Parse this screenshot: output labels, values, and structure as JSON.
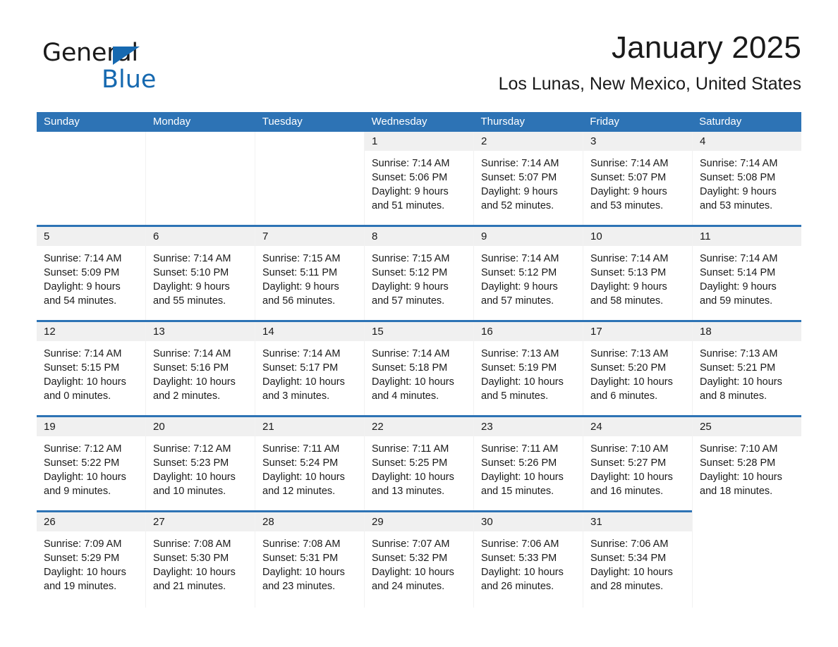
{
  "brand": {
    "name_part1": "General",
    "name_part2": "Blue",
    "accent_color": "#1669b0"
  },
  "header": {
    "month_title": "January 2025",
    "location": "Los Lunas, New Mexico, United States"
  },
  "theme": {
    "header_blue": "#2d73b5",
    "datenum_gray": "#f0f0f0",
    "cell_white": "#ffffff"
  },
  "weekdays": [
    "Sunday",
    "Monday",
    "Tuesday",
    "Wednesday",
    "Thursday",
    "Friday",
    "Saturday"
  ],
  "weeks": [
    [
      {
        "day": "",
        "lines": [],
        "blank": true
      },
      {
        "day": "",
        "lines": [],
        "blank": true
      },
      {
        "day": "",
        "lines": [],
        "blank": true
      },
      {
        "day": "1",
        "lines": [
          "Sunrise: 7:14 AM",
          "Sunset: 5:06 PM",
          "Daylight: 9 hours",
          "and 51 minutes."
        ]
      },
      {
        "day": "2",
        "lines": [
          "Sunrise: 7:14 AM",
          "Sunset: 5:07 PM",
          "Daylight: 9 hours",
          "and 52 minutes."
        ]
      },
      {
        "day": "3",
        "lines": [
          "Sunrise: 7:14 AM",
          "Sunset: 5:07 PM",
          "Daylight: 9 hours",
          "and 53 minutes."
        ]
      },
      {
        "day": "4",
        "lines": [
          "Sunrise: 7:14 AM",
          "Sunset: 5:08 PM",
          "Daylight: 9 hours",
          "and 53 minutes."
        ]
      }
    ],
    [
      {
        "day": "5",
        "lines": [
          "Sunrise: 7:14 AM",
          "Sunset: 5:09 PM",
          "Daylight: 9 hours",
          "and 54 minutes."
        ]
      },
      {
        "day": "6",
        "lines": [
          "Sunrise: 7:14 AM",
          "Sunset: 5:10 PM",
          "Daylight: 9 hours",
          "and 55 minutes."
        ]
      },
      {
        "day": "7",
        "lines": [
          "Sunrise: 7:15 AM",
          "Sunset: 5:11 PM",
          "Daylight: 9 hours",
          "and 56 minutes."
        ]
      },
      {
        "day": "8",
        "lines": [
          "Sunrise: 7:15 AM",
          "Sunset: 5:12 PM",
          "Daylight: 9 hours",
          "and 57 minutes."
        ]
      },
      {
        "day": "9",
        "lines": [
          "Sunrise: 7:14 AM",
          "Sunset: 5:12 PM",
          "Daylight: 9 hours",
          "and 57 minutes."
        ]
      },
      {
        "day": "10",
        "lines": [
          "Sunrise: 7:14 AM",
          "Sunset: 5:13 PM",
          "Daylight: 9 hours",
          "and 58 minutes."
        ]
      },
      {
        "day": "11",
        "lines": [
          "Sunrise: 7:14 AM",
          "Sunset: 5:14 PM",
          "Daylight: 9 hours",
          "and 59 minutes."
        ]
      }
    ],
    [
      {
        "day": "12",
        "lines": [
          "Sunrise: 7:14 AM",
          "Sunset: 5:15 PM",
          "Daylight: 10 hours",
          "and 0 minutes."
        ]
      },
      {
        "day": "13",
        "lines": [
          "Sunrise: 7:14 AM",
          "Sunset: 5:16 PM",
          "Daylight: 10 hours",
          "and 2 minutes."
        ]
      },
      {
        "day": "14",
        "lines": [
          "Sunrise: 7:14 AM",
          "Sunset: 5:17 PM",
          "Daylight: 10 hours",
          "and 3 minutes."
        ]
      },
      {
        "day": "15",
        "lines": [
          "Sunrise: 7:14 AM",
          "Sunset: 5:18 PM",
          "Daylight: 10 hours",
          "and 4 minutes."
        ]
      },
      {
        "day": "16",
        "lines": [
          "Sunrise: 7:13 AM",
          "Sunset: 5:19 PM",
          "Daylight: 10 hours",
          "and 5 minutes."
        ]
      },
      {
        "day": "17",
        "lines": [
          "Sunrise: 7:13 AM",
          "Sunset: 5:20 PM",
          "Daylight: 10 hours",
          "and 6 minutes."
        ]
      },
      {
        "day": "18",
        "lines": [
          "Sunrise: 7:13 AM",
          "Sunset: 5:21 PM",
          "Daylight: 10 hours",
          "and 8 minutes."
        ]
      }
    ],
    [
      {
        "day": "19",
        "lines": [
          "Sunrise: 7:12 AM",
          "Sunset: 5:22 PM",
          "Daylight: 10 hours",
          "and 9 minutes."
        ]
      },
      {
        "day": "20",
        "lines": [
          "Sunrise: 7:12 AM",
          "Sunset: 5:23 PM",
          "Daylight: 10 hours",
          "and 10 minutes."
        ]
      },
      {
        "day": "21",
        "lines": [
          "Sunrise: 7:11 AM",
          "Sunset: 5:24 PM",
          "Daylight: 10 hours",
          "and 12 minutes."
        ]
      },
      {
        "day": "22",
        "lines": [
          "Sunrise: 7:11 AM",
          "Sunset: 5:25 PM",
          "Daylight: 10 hours",
          "and 13 minutes."
        ]
      },
      {
        "day": "23",
        "lines": [
          "Sunrise: 7:11 AM",
          "Sunset: 5:26 PM",
          "Daylight: 10 hours",
          "and 15 minutes."
        ]
      },
      {
        "day": "24",
        "lines": [
          "Sunrise: 7:10 AM",
          "Sunset: 5:27 PM",
          "Daylight: 10 hours",
          "and 16 minutes."
        ]
      },
      {
        "day": "25",
        "lines": [
          "Sunrise: 7:10 AM",
          "Sunset: 5:28 PM",
          "Daylight: 10 hours",
          "and 18 minutes."
        ]
      }
    ],
    [
      {
        "day": "26",
        "lines": [
          "Sunrise: 7:09 AM",
          "Sunset: 5:29 PM",
          "Daylight: 10 hours",
          "and 19 minutes."
        ]
      },
      {
        "day": "27",
        "lines": [
          "Sunrise: 7:08 AM",
          "Sunset: 5:30 PM",
          "Daylight: 10 hours",
          "and 21 minutes."
        ]
      },
      {
        "day": "28",
        "lines": [
          "Sunrise: 7:08 AM",
          "Sunset: 5:31 PM",
          "Daylight: 10 hours",
          "and 23 minutes."
        ]
      },
      {
        "day": "29",
        "lines": [
          "Sunrise: 7:07 AM",
          "Sunset: 5:32 PM",
          "Daylight: 10 hours",
          "and 24 minutes."
        ]
      },
      {
        "day": "30",
        "lines": [
          "Sunrise: 7:06 AM",
          "Sunset: 5:33 PM",
          "Daylight: 10 hours",
          "and 26 minutes."
        ]
      },
      {
        "day": "31",
        "lines": [
          "Sunrise: 7:06 AM",
          "Sunset: 5:34 PM",
          "Daylight: 10 hours",
          "and 28 minutes."
        ]
      },
      {
        "day": "",
        "lines": [],
        "blank": true
      }
    ]
  ]
}
